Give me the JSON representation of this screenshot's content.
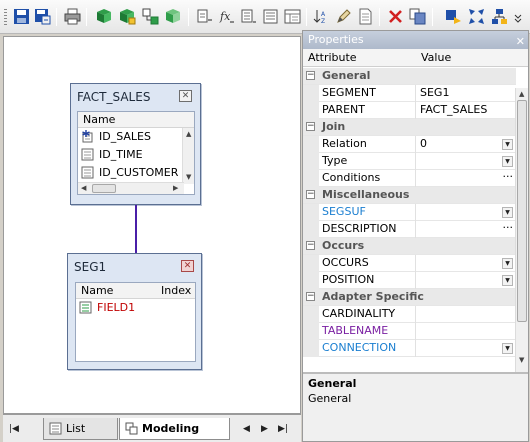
{
  "toolbar": {
    "buttons": [
      {
        "icon": "save-icon"
      },
      {
        "icon": "save-as-icon"
      },
      {
        "icon": "print-icon"
      },
      {
        "icon": "add-segment-icon"
      },
      {
        "icon": "add-child-segment-icon"
      },
      {
        "icon": "add-reference-icon"
      },
      {
        "icon": "add-cube-icon"
      },
      {
        "icon": "insert-field-icon"
      },
      {
        "icon": "insert-expression-icon"
      },
      {
        "icon": "insert-group-icon"
      },
      {
        "icon": "insert-list-icon"
      },
      {
        "icon": "sort-icon"
      },
      {
        "icon": "edit-icon"
      },
      {
        "icon": "document-icon"
      },
      {
        "icon": "delete-icon"
      },
      {
        "icon": "copy-icon"
      },
      {
        "icon": "sync-icon"
      },
      {
        "icon": "expand-icon"
      },
      {
        "icon": "diagram-icon"
      }
    ]
  },
  "canvas": {
    "segments": [
      {
        "title": "FACT_SALES",
        "column_header": "Name",
        "fields": [
          {
            "name": "ID_SALES",
            "icon": "key-field-icon"
          },
          {
            "name": "ID_TIME",
            "icon": "field-icon"
          },
          {
            "name": "ID_CUSTOMER",
            "icon": "field-icon"
          }
        ]
      },
      {
        "title": "SEG1",
        "column_header": "Name",
        "column_header_2": "Index",
        "fields": [
          {
            "name": "FIELD1",
            "icon": "field-icon"
          }
        ]
      }
    ]
  },
  "tabs": {
    "items": [
      {
        "label": "List View",
        "active": false
      },
      {
        "label": "Modeling View",
        "active": true
      }
    ]
  },
  "properties": {
    "title": "Properties",
    "col_attribute": "Attribute",
    "col_value": "Value",
    "rows": [
      {
        "type": "category",
        "label": "General"
      },
      {
        "type": "prop",
        "name": "SEGMENT",
        "value": "SEG1"
      },
      {
        "type": "prop",
        "name": "PARENT",
        "value": "FACT_SALES"
      },
      {
        "type": "category",
        "label": "Join"
      },
      {
        "type": "prop",
        "name": "Relation",
        "value": "0",
        "control": "dropdown"
      },
      {
        "type": "prop",
        "name": "Type",
        "value": "",
        "control": "dropdown"
      },
      {
        "type": "prop",
        "name": "Conditions",
        "value": "",
        "control": "ellipsis"
      },
      {
        "type": "category",
        "label": "Miscellaneous"
      },
      {
        "type": "prop",
        "name": "SEGSUF",
        "value": "",
        "control": "dropdown",
        "color": "blue"
      },
      {
        "type": "prop",
        "name": "DESCRIPTION",
        "value": "",
        "control": "ellipsis"
      },
      {
        "type": "category",
        "label": "Occurs"
      },
      {
        "type": "prop",
        "name": "OCCURS",
        "value": "",
        "control": "dropdown"
      },
      {
        "type": "prop",
        "name": "POSITION",
        "value": "",
        "control": "dropdown"
      },
      {
        "type": "category",
        "label": "Adapter Specific"
      },
      {
        "type": "prop",
        "name": "CARDINALITY",
        "value": ""
      },
      {
        "type": "prop",
        "name": "TABLENAME",
        "value": "",
        "color": "purple"
      },
      {
        "type": "prop",
        "name": "CONNECTION",
        "value": "",
        "control": "dropdown",
        "color": "blue"
      }
    ],
    "description": {
      "title": "General",
      "text": "General"
    }
  },
  "colors": {
    "segment_bg": "#dde6f3",
    "connector": "#4a1fa8",
    "field_red": "#c00000",
    "blue_attr": "#1a7ed0",
    "purple_attr": "#7a1fa2"
  }
}
